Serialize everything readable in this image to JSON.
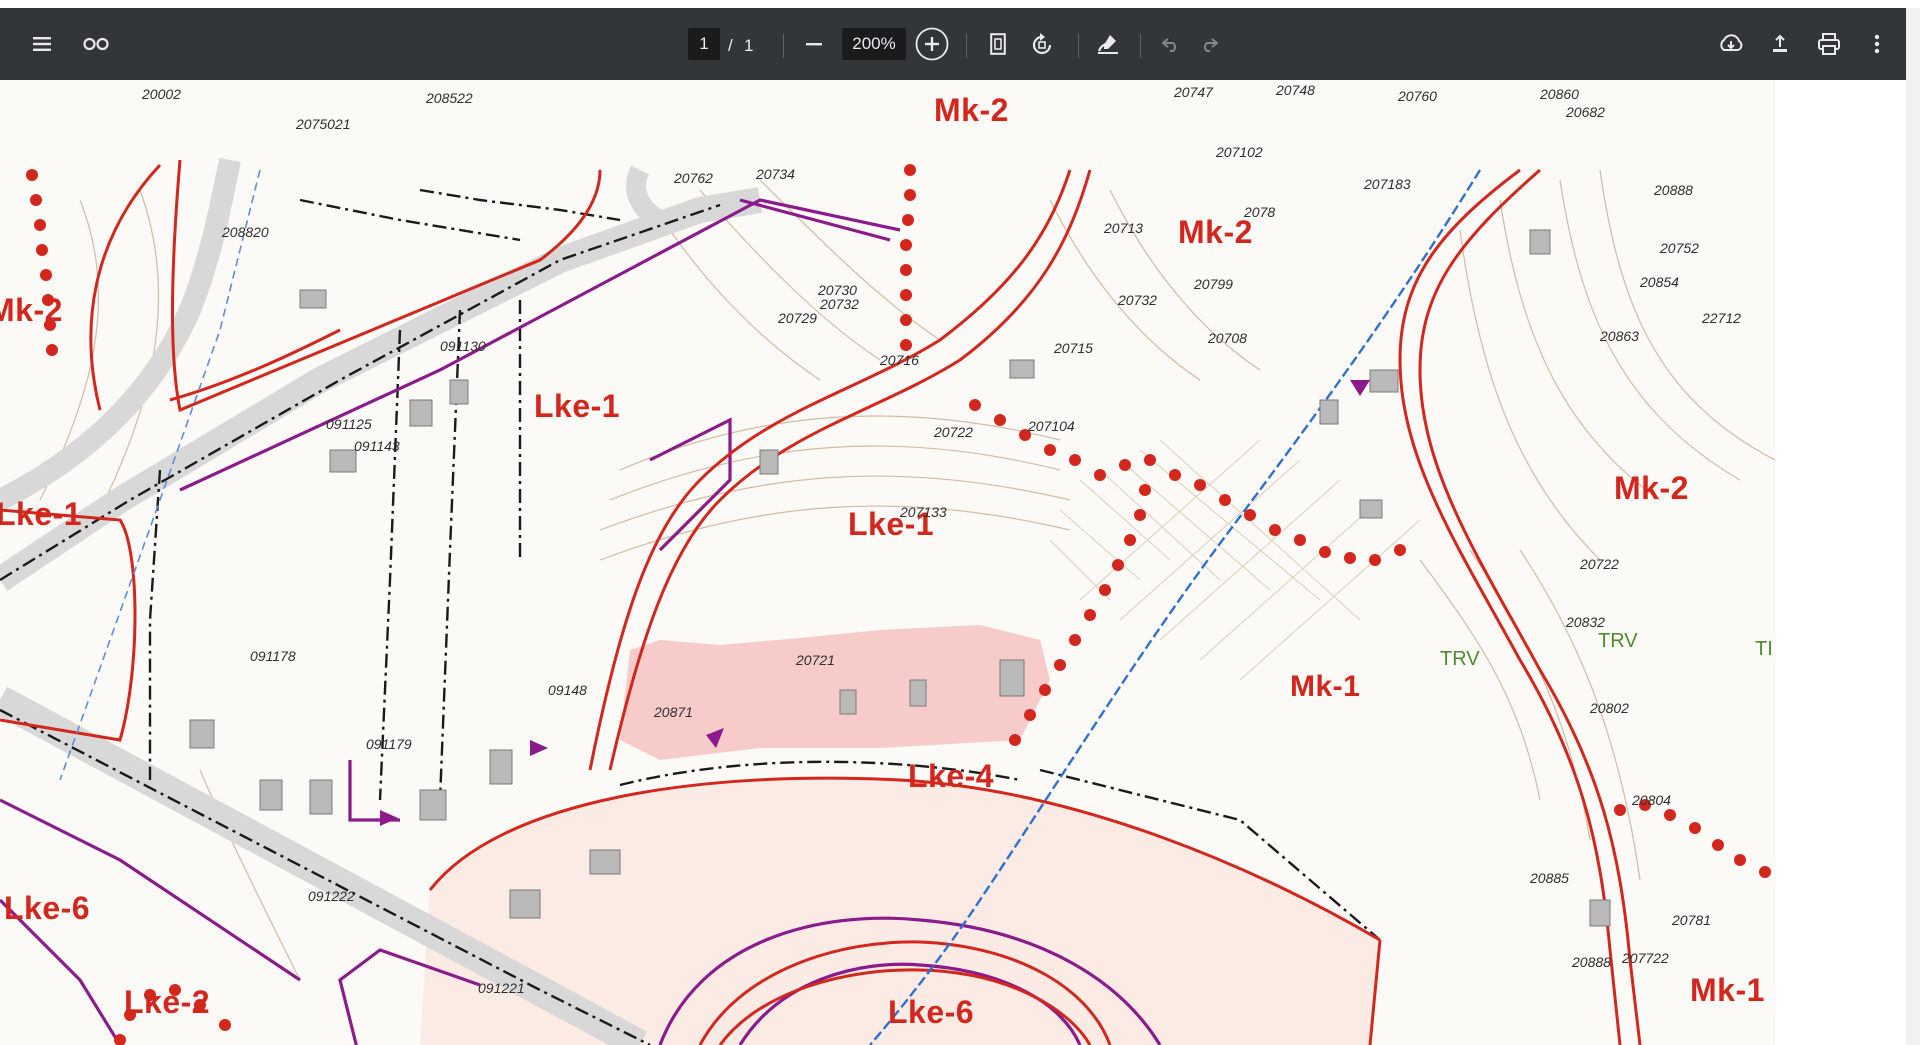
{
  "toolbar": {
    "page_current": "1",
    "page_separator": "/",
    "page_total": "1",
    "zoom": "200%",
    "icons": [
      "menu-icon",
      "two-page-icon",
      "zoom-out-icon",
      "zoom-in-icon",
      "fit-page-icon",
      "rotate-icon",
      "annotate-icon",
      "undo-icon",
      "redo-icon",
      "download-icon",
      "share-icon",
      "print-icon",
      "more-icon"
    ]
  },
  "map": {
    "zones": {
      "mk2_top": "Mk-2",
      "mk2_center": "Mk-2",
      "mk2_right": "Mk-2",
      "mk2_left": "Mk-2",
      "lke1_center": "Lke-1",
      "lke1_left": "Lke-1",
      "lke1_mid": "Lke-1",
      "mk1_center": "Mk-1",
      "mk1_bottom_right": "Mk-1",
      "lke4": "Lke-4",
      "lke6_left": "Lke-6",
      "lke6_bottom": "Lke-6",
      "lke2": "Lke-2"
    },
    "trv_labels": [
      "TRV",
      "TRV",
      "TI"
    ],
    "parcels": [
      "20002",
      "208522",
      "2075021",
      "208820",
      "20747",
      "20748",
      "20760",
      "20860",
      "20682",
      "207102",
      "20713",
      "20734",
      "207183",
      "20732",
      "20732",
      "20888",
      "2078",
      "20799",
      "20715",
      "20708",
      "20716",
      "20863",
      "20729",
      "20730",
      "20752",
      "20854",
      "20762",
      "20722",
      "22712",
      "20832",
      "091130",
      "091143",
      "091125",
      "207133",
      "207104",
      "20722",
      "20721",
      "20871",
      "20802",
      "20804",
      "09148",
      "091178",
      "091179",
      "20888",
      "091222",
      "20885",
      "20781",
      "207722",
      "091221"
    ]
  },
  "colors": {
    "toolbar_bg": "#323639",
    "zone_red": "#d3271d",
    "boundary_purple": "#8b1a8b",
    "contour_brown": "#b98a6a",
    "stream_blue": "#2f6fd0"
  }
}
